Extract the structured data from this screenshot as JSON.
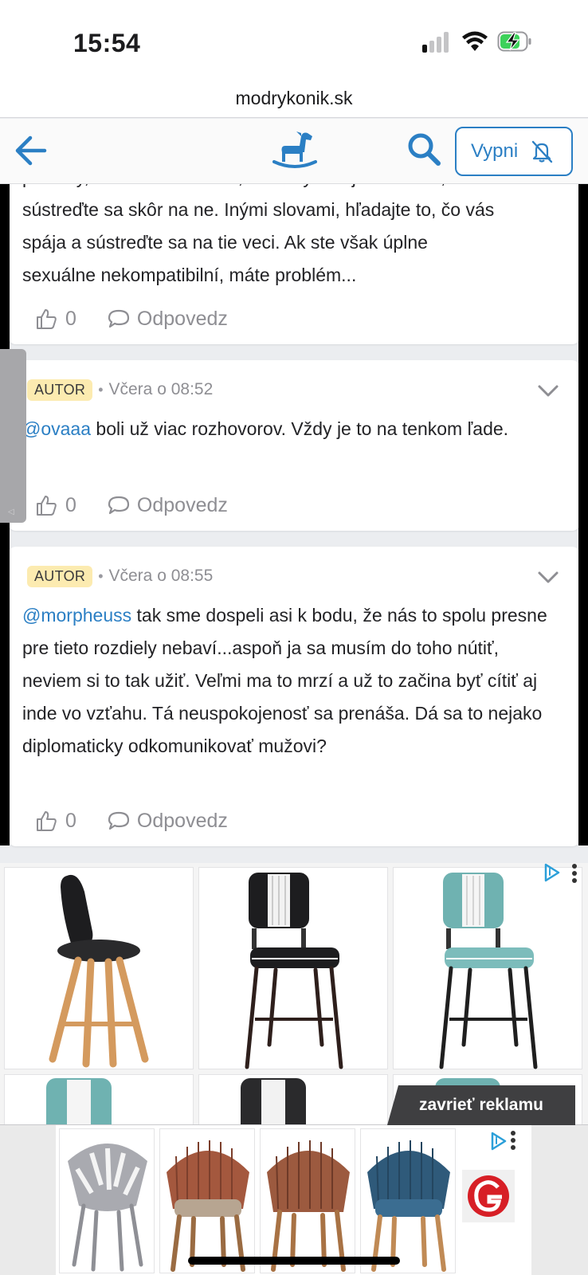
{
  "status_bar": {
    "time": "15:54"
  },
  "browser": {
    "url": "modrykonik.sk"
  },
  "header": {
    "mute_button_label": "Vypni"
  },
  "comments": [
    {
      "text_lines": [
        "praktiky, sexuálne scenáre, ktoré vyhovujú obidvom,",
        "sústreďte sa skôr na ne. Inými slovami, hľadajte to, čo vás",
        "spája a sústreďte sa na tie veci. Ak ste však úplne",
        "sexuálne nekompatibilní, máte problém..."
      ],
      "likes": "0",
      "reply_label": "Odpovedz"
    },
    {
      "badge": "AUTOR",
      "time": "Včera o 08:52",
      "mention": "@ovaaa",
      "text": " boli už viac rozhovorov. Vždy je to na tenkom ľade.",
      "likes": "0",
      "reply_label": "Odpovedz"
    },
    {
      "badge": "AUTOR",
      "time": "Včera o 08:55",
      "mention": "@morpheuss",
      "text": " tak sme dospeli asi k bodu, že nás to spolu presne pre tieto rozdiely nebaví...aspoň ja sa musím do toho nútiť, neviem si to tak užiť. Veľmi ma to mrzí a už to začina byť cítiť aj inde vo vzťahu. Tá neuspokojenosť sa prenáša. Dá sa to nejako diplomaticky odkomunikovať mužovi?",
      "likes": "0",
      "reply_label": "Odpovedz"
    }
  ],
  "ad": {
    "close_label": "zavrieť reklamu",
    "products": [
      "black-stool",
      "retro-black-stool",
      "retro-teal-stool"
    ],
    "bottom_products": [
      "grey-lattice-chair",
      "rattan-chair-brown",
      "rattan-chair-brown",
      "rattan-chair-blue"
    ],
    "colors": {
      "teal": "#6fb2b1",
      "wood": "#d49a5e",
      "brand_blue": "#2b7fc4",
      "badge_yellow": "#fcebb0"
    }
  }
}
